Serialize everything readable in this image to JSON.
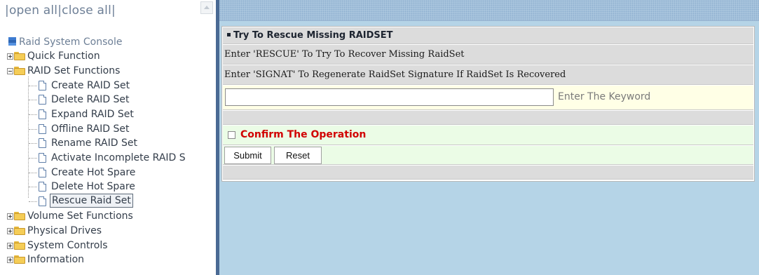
{
  "left_frame": {
    "open_all": "open all",
    "close_all": "close all",
    "separator": "|"
  },
  "tree": {
    "root": "Raid System Console",
    "nodes": [
      {
        "label": "Quick Function",
        "expanded": false
      },
      {
        "label": "RAID Set Functions",
        "expanded": true,
        "children": [
          "Create RAID Set",
          "Delete RAID Set",
          "Expand RAID Set",
          "Offline RAID Set",
          "Rename RAID Set",
          "Activate Incomplete RAID S",
          "Create Hot Spare",
          "Delete Hot Spare",
          "Rescue Raid Set"
        ],
        "selected_child": "Rescue Raid Set"
      },
      {
        "label": "Volume Set Functions",
        "expanded": false
      },
      {
        "label": "Physical Drives",
        "expanded": false
      },
      {
        "label": "System Controls",
        "expanded": false
      },
      {
        "label": "Information",
        "expanded": false
      }
    ]
  },
  "form": {
    "title": "Try To Rescue Missing RAIDSET",
    "instruction_1": "Enter 'RESCUE' To Try To Recover Missing RaidSet",
    "instruction_2": "Enter 'SIGNAT' To Regenerate RaidSet Signature If RaidSet Is Recovered",
    "keyword_value": "",
    "keyword_hint": "Enter The Keyword",
    "confirm_label": "Confirm The Operation",
    "confirm_checked": false,
    "submit_label": "Submit",
    "reset_label": "Reset"
  },
  "colors": {
    "splitter": "#4a6a94",
    "right_background": "#b5d4e7",
    "confirm_text": "#d10000",
    "row_gray": "#dcdcdc",
    "input_row": "#ffffe6",
    "confirm_row": "#ebfce6"
  },
  "icons": {
    "root": "raid-console-icon",
    "folder": "folder-icon",
    "page": "page-icon",
    "expand": "plus-box-icon",
    "collapse": "minus-box-icon"
  }
}
